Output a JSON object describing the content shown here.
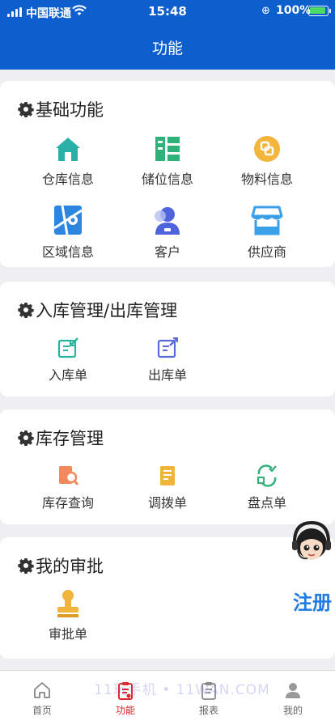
{
  "status": {
    "carrier": "中国联通",
    "time": "15:48",
    "battery": "100%",
    "icons": [
      "signal-icon",
      "wifi-icon",
      "orientation-lock-icon",
      "battery-icon"
    ]
  },
  "header": {
    "title": "功能"
  },
  "sections": [
    {
      "title": "基础功能",
      "items": [
        {
          "label": "仓库信息",
          "icon": "warehouse-icon"
        },
        {
          "label": "储位信息",
          "icon": "storage-location-icon"
        },
        {
          "label": "物料信息",
          "icon": "material-icon"
        },
        {
          "label": "区域信息",
          "icon": "area-map-icon"
        },
        {
          "label": "客户",
          "icon": "customer-icon"
        },
        {
          "label": "供应商",
          "icon": "supplier-store-icon"
        }
      ]
    },
    {
      "title": "入库管理/出库管理",
      "items": [
        {
          "label": "入库单",
          "icon": "inbound-order-icon"
        },
        {
          "label": "出库单",
          "icon": "outbound-order-icon"
        }
      ]
    },
    {
      "title": "库存管理",
      "items": [
        {
          "label": "库存查询",
          "icon": "inventory-search-icon"
        },
        {
          "label": "调拨单",
          "icon": "transfer-order-icon"
        },
        {
          "label": "盘点单",
          "icon": "stocktake-icon"
        }
      ]
    },
    {
      "title": "我的审批",
      "items": [
        {
          "label": "审批单",
          "icon": "approval-stamp-icon"
        }
      ]
    }
  ],
  "floating": {
    "label": "注册",
    "icon": "support-agent-avatar-icon"
  },
  "tabbar": {
    "tabs": [
      {
        "label": "首页",
        "icon": "home-icon"
      },
      {
        "label": "功能",
        "icon": "function-clipboard-icon",
        "active": true
      },
      {
        "label": "报表",
        "icon": "report-icon"
      },
      {
        "label": "我的",
        "icon": "profile-icon"
      }
    ],
    "active_color": "#e0242b"
  },
  "watermark": "11玩手机 • 11WAN.COM",
  "colors": {
    "header_bg": "#0d5fcd",
    "accent_blue": "#1e7be0"
  }
}
